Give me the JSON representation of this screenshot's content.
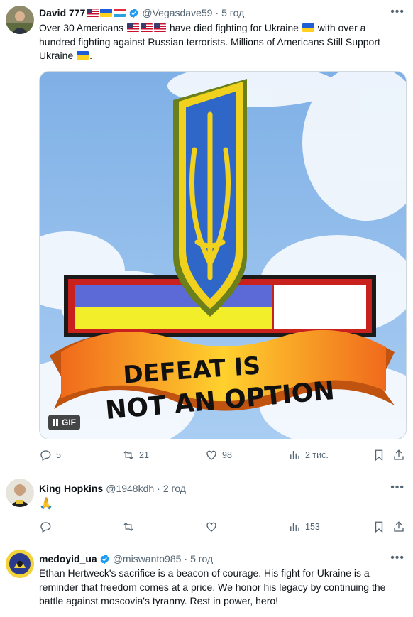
{
  "posts": [
    {
      "author": "David 777",
      "handle": "@Vegasdave59",
      "time": "5 год",
      "text_parts": [
        "Over 30 Americans",
        "have died fighting for Ukraine",
        "with over a hundred fighting against Russian terrorists. Millions of Americans Still Support Ukraine",
        "."
      ],
      "media": {
        "banner_line1": "DEFEAT IS",
        "banner_line2": "NOT AN OPTION",
        "badge": "GIF"
      },
      "stats": {
        "replies": "5",
        "reposts": "21",
        "likes": "98",
        "views": "2 тис."
      }
    },
    {
      "author": "King Hopkins",
      "handle": "@1948kdh",
      "time": "2 год",
      "text": "🙏",
      "stats": {
        "replies": "",
        "reposts": "",
        "likes": "",
        "views": "153"
      }
    },
    {
      "author": "medoyid_ua",
      "handle": "@miswanto985",
      "time": "5 год",
      "text": "Ethan Hertweck's sacrifice is a beacon of courage. His fight for Ukraine is a reminder that freedom comes at a price. We honor his legacy by continuing the battle against moscovia's tyranny. Rest in power, hero!"
    }
  ],
  "colors": {
    "verified": "#1d9bf0",
    "muted": "#536471",
    "ua_blue": "#1f5fd6",
    "ua_yellow": "#ffd21f"
  },
  "icons": [
    "verified-badge-icon",
    "more-icon",
    "reply-icon",
    "repost-icon",
    "like-icon",
    "views-icon",
    "bookmark-icon",
    "share-icon",
    "pause-icon"
  ]
}
